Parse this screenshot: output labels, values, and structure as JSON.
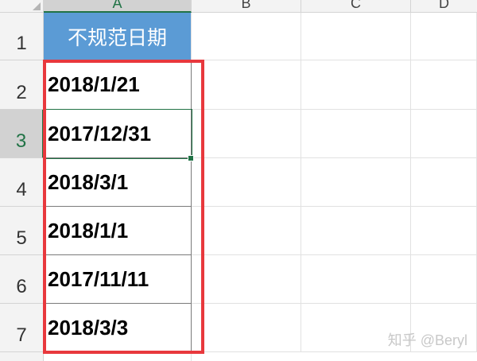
{
  "columns": [
    "A",
    "B",
    "C",
    "D"
  ],
  "rows": [
    "1",
    "2",
    "3",
    "4",
    "5",
    "6",
    "7"
  ],
  "header_cell": "不规范日期",
  "dates": [
    "2018/1/21",
    "2017/12/31",
    "2018/3/1",
    "2018/1/1",
    "2017/11/11",
    "2018/3/3"
  ],
  "active_cell": "A3",
  "watermark": "知乎 @Beryl",
  "colors": {
    "header_fill": "#5b9bd5",
    "highlight_box": "#e8383d",
    "selection": "#217346"
  }
}
